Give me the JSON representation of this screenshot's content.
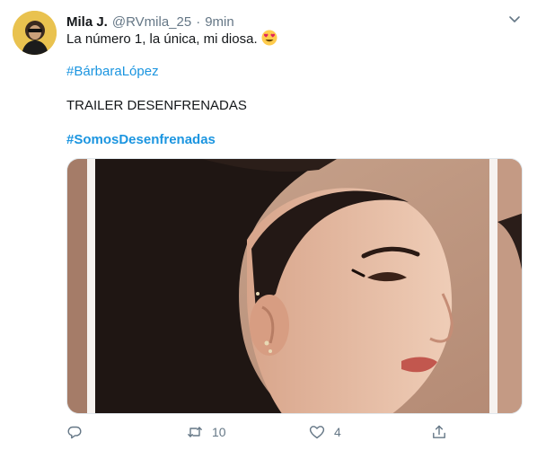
{
  "tweet": {
    "display_name": "Mila J.",
    "handle": "@RVmila_25",
    "separator": "·",
    "time": "9min",
    "text_line1": "La número 1, la única, mi diosa.",
    "emoji": "heart-eyes-emoji",
    "hashtag1": "#BárbaraLópez",
    "text_line2": "TRAILER DESENFRENADAS",
    "hashtag2": "#SomosDesenfrenadas"
  },
  "actions": {
    "reply_count": "",
    "retweet_count": "10",
    "like_count": "4"
  },
  "colors": {
    "link": "#1b95e0",
    "muted": "#657786",
    "text": "#14171a"
  }
}
